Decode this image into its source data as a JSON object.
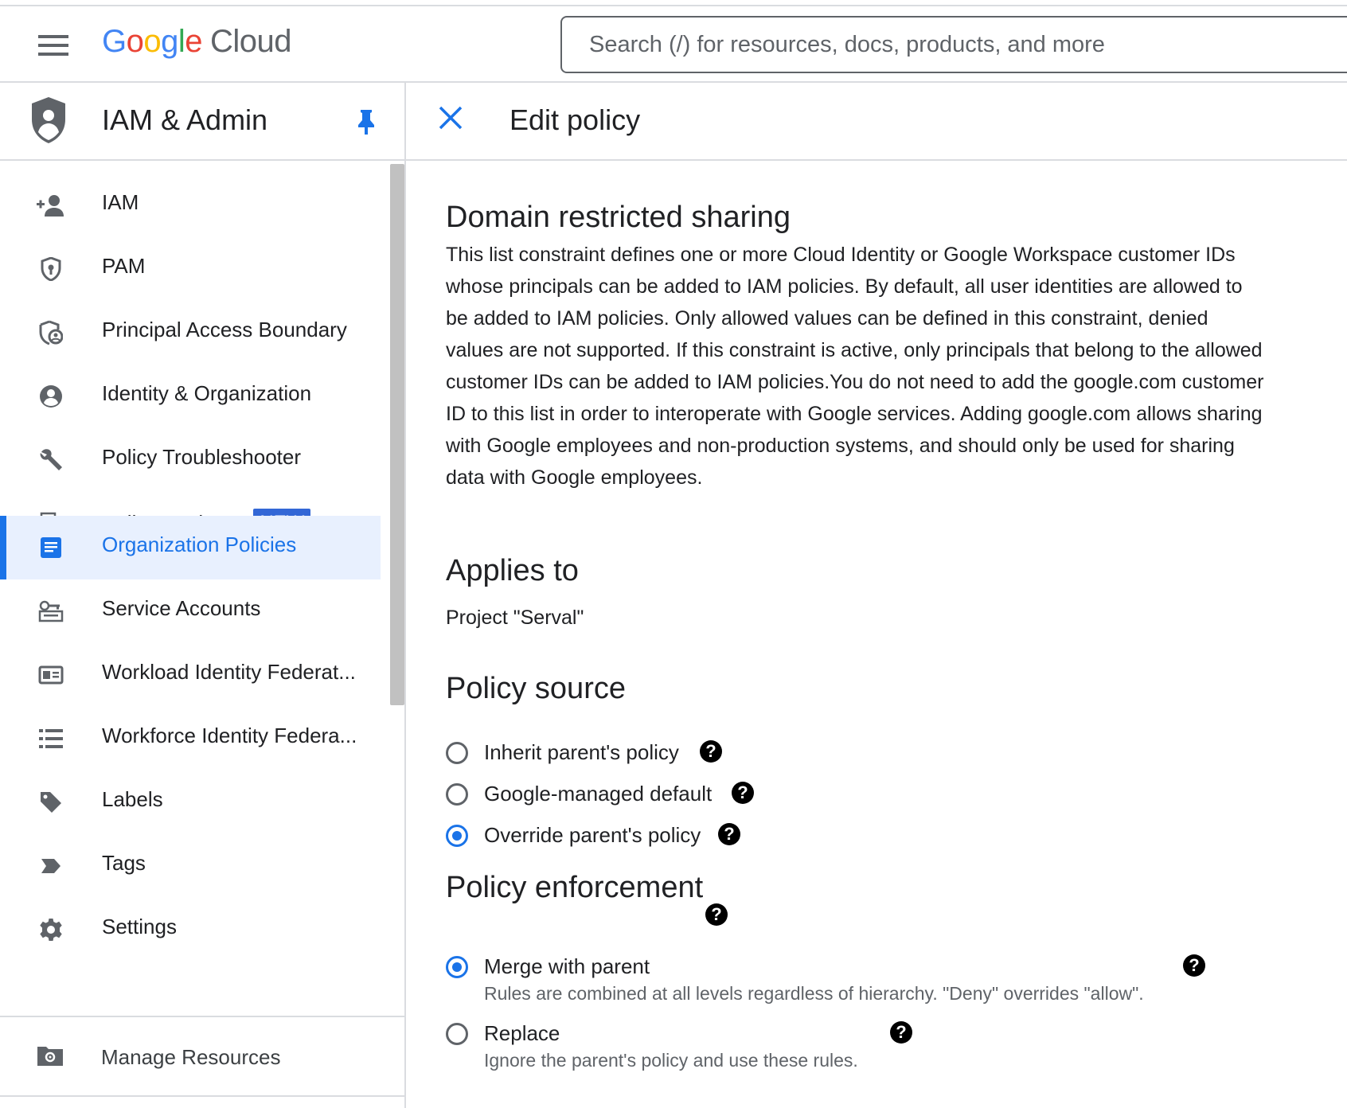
{
  "header": {
    "logo_google": [
      "G",
      "o",
      "o",
      "g",
      "l",
      "e"
    ],
    "logo_cloud": "Cloud",
    "search_placeholder": "Search (/) for resources, docs, products, and more"
  },
  "sidebar": {
    "title": "IAM & Admin",
    "items": [
      {
        "label": "IAM",
        "icon": "person-add-icon"
      },
      {
        "label": "PAM",
        "icon": "shield-lock-icon"
      },
      {
        "label": "Principal Access Boundary",
        "icon": "shield-person-icon"
      },
      {
        "label": "Identity & Organization",
        "icon": "account-circle-icon"
      },
      {
        "label": "Policy Troubleshooter",
        "icon": "wrench-icon"
      },
      {
        "label": "Policy Analyzer",
        "icon": "document-search-icon",
        "badge": "NEW"
      },
      {
        "label": "Organization Policies",
        "icon": "list-document-icon",
        "active": true
      },
      {
        "label": "Service Accounts",
        "icon": "service-account-icon"
      },
      {
        "label": "Workload Identity Federat...",
        "icon": "id-card-icon"
      },
      {
        "label": "Workforce Identity Federa...",
        "icon": "list-icon"
      },
      {
        "label": "Labels",
        "icon": "tag-icon"
      },
      {
        "label": "Tags",
        "icon": "label-arrow-icon"
      },
      {
        "label": "Settings",
        "icon": "gear-icon"
      }
    ],
    "manage_resources": "Manage Resources"
  },
  "panel": {
    "title": "Edit policy"
  },
  "policy": {
    "name": "Domain restricted sharing",
    "description": "This list constraint defines one or more Cloud Identity or Google Workspace customer IDs whose principals can be added to IAM policies. By default, all user identities are allowed to be added to IAM policies. Only allowed values can be defined in this constraint, denied values are not supported. If this constraint is active, only principals that belong to the allowed customer IDs can be added to IAM policies.You do not need to add the google.com customer ID to this list in order to interoperate with Google services. Adding google.com allows sharing with Google employees and non-production systems, and should only be used for sharing data with Google employees.",
    "applies_to_heading": "Applies to",
    "applies_to_value": "Project \"Serval\"",
    "source_heading": "Policy source",
    "source_options": [
      {
        "label": "Inherit parent's policy",
        "selected": false
      },
      {
        "label": "Google-managed default",
        "selected": false
      },
      {
        "label": "Override parent's policy",
        "selected": true
      }
    ],
    "enforcement_heading": "Policy enforcement",
    "enforcement_options": [
      {
        "label": "Merge with parent",
        "description": "Rules are combined at all levels regardless of hierarchy. \"Deny\" overrides \"allow\".",
        "selected": true
      },
      {
        "label": "Replace",
        "description": "Ignore the parent's policy and use these rules.",
        "selected": false
      }
    ]
  },
  "colors": {
    "accent": "#1a73e8",
    "active_bg": "#e8f0fe",
    "badge_bg": "#3367d6",
    "icon_gray": "#5f6368"
  }
}
